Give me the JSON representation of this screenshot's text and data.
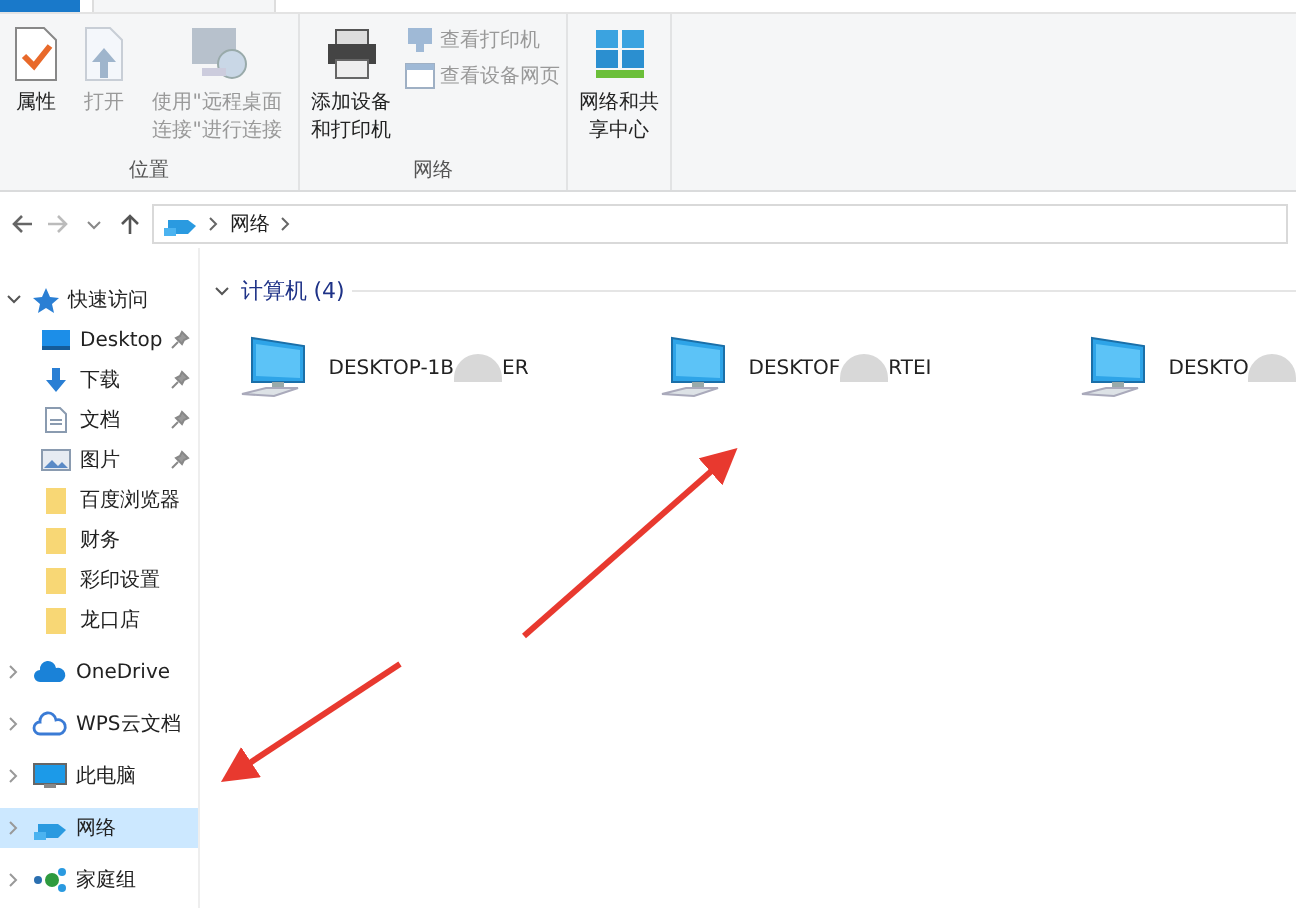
{
  "ribbon": {
    "groups": [
      {
        "label": "位置",
        "buttons": [
          {
            "kind": "large",
            "label": "属性",
            "disabled": false
          },
          {
            "kind": "large",
            "label": "打开",
            "disabled": true
          },
          {
            "kind": "large",
            "label": "使用\"远程桌面连接\"进行连接",
            "disabled": true
          }
        ]
      },
      {
        "label": "网络",
        "buttons": [
          {
            "kind": "large",
            "label": "添加设备和打印机",
            "disabled": false
          },
          {
            "kind": "small",
            "label": "查看打印机",
            "disabled": true
          },
          {
            "kind": "small",
            "label": "查看设备网页",
            "disabled": true
          }
        ]
      },
      {
        "buttons": [
          {
            "kind": "large",
            "label": "网络和共享中心",
            "disabled": false
          }
        ]
      }
    ]
  },
  "address": {
    "crumbs": [
      "网络"
    ]
  },
  "sidebar": {
    "items": [
      {
        "label": "快速访问",
        "expanded": true,
        "selected": false,
        "children": [
          {
            "label": "Desktop",
            "pinned": true,
            "selected": false
          },
          {
            "label": "下载",
            "pinned": true,
            "selected": false
          },
          {
            "label": "文档",
            "pinned": true,
            "selected": false
          },
          {
            "label": "图片",
            "pinned": true,
            "selected": false
          },
          {
            "label": "百度浏览器",
            "pinned": false,
            "selected": false
          },
          {
            "label": "财务",
            "pinned": false,
            "selected": false
          },
          {
            "label": "彩印设置",
            "pinned": false,
            "selected": false
          },
          {
            "label": "龙口店",
            "pinned": false,
            "selected": false
          }
        ]
      },
      {
        "label": "OneDrive",
        "expanded": false,
        "selected": false
      },
      {
        "label": "WPS云文档",
        "expanded": false,
        "selected": false
      },
      {
        "label": "此电脑",
        "expanded": false,
        "selected": false
      },
      {
        "label": "网络",
        "expanded": false,
        "selected": true
      },
      {
        "label": "家庭组",
        "expanded": false,
        "selected": false
      }
    ]
  },
  "content": {
    "section": {
      "title": "计算机 (4)",
      "expanded": true
    },
    "computers": [
      {
        "name_start": "DESKTOP-1B",
        "name_end": "ER"
      },
      {
        "name_start": "DESKTOF",
        "name_end": "RTEI"
      },
      {
        "name_start": "DESKTO"
      }
    ]
  }
}
